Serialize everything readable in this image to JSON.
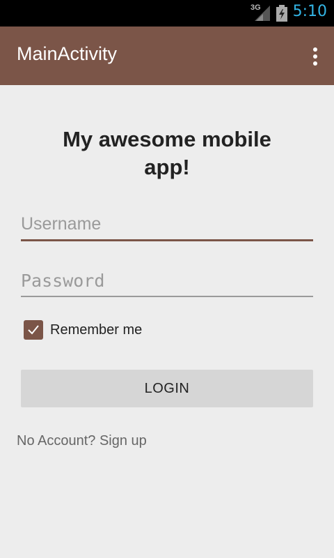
{
  "status_bar": {
    "network": "3G",
    "time": "5:10",
    "icons": [
      "signal-icon",
      "battery-charging-icon"
    ],
    "clock_color": "#33b5e5"
  },
  "action_bar": {
    "title": "MainActivity",
    "menu_icon": "overflow-menu-icon",
    "color": "#7b5548"
  },
  "main": {
    "headline": "My awesome mobile app!",
    "username": {
      "placeholder": "Username",
      "value": ""
    },
    "password": {
      "placeholder": "Password",
      "value": ""
    },
    "remember": {
      "label": "Remember me",
      "checked": true
    },
    "login_label": "LOGIN",
    "signup_text": "No Account? Sign up"
  }
}
